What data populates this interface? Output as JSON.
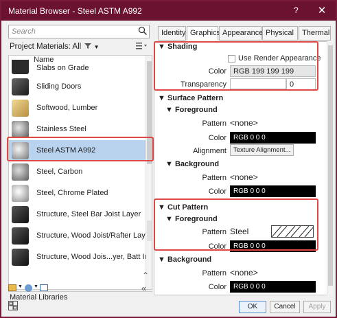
{
  "window": {
    "title": "Material Browser - Steel ASTM A992",
    "help": "?",
    "close": "✕"
  },
  "left": {
    "search_placeholder": "Search",
    "project_header": "Project Materials: All",
    "column_header": "Name",
    "items": [
      {
        "name": "Slabs on Grade",
        "thumb": "#2a2a2a"
      },
      {
        "name": "Sliding Doors",
        "thumb": "#3a3a3a"
      },
      {
        "name": "Softwood, Lumber",
        "thumb": "#d9b86a"
      },
      {
        "name": "Stainless Steel",
        "thumb": "#9a9a9a"
      },
      {
        "name": "Steel ASTM A992",
        "thumb": "#b8b8b8"
      },
      {
        "name": "Steel, Carbon",
        "thumb": "#9e9e9e"
      },
      {
        "name": "Steel, Chrome Plated",
        "thumb": "#c8c8c8"
      },
      {
        "name": "Structure, Steel Bar Joist Layer",
        "thumb": "#2e2e2e"
      },
      {
        "name": "Structure, Wood Joist/Rafter Layer",
        "thumb": "#333333"
      },
      {
        "name": "Structure, Wood Jois...yer, Batt Insulation",
        "thumb": "#3a3a3a"
      }
    ],
    "library_header": "Material Libraries"
  },
  "tabs": [
    "Identity",
    "Graphics",
    "Appearance",
    "Physical",
    "Thermal"
  ],
  "graphics": {
    "shading": {
      "title": "Shading",
      "use_render_label": "Use Render Appearance",
      "color_label": "Color",
      "color_value": "RGB 199 199 199",
      "transparency_label": "Transparency",
      "transparency_value": "0"
    },
    "surface": {
      "title": "Surface Pattern",
      "foreground": {
        "title": "Foreground",
        "pattern_label": "Pattern",
        "pattern_value": "<none>",
        "color_label": "Color",
        "color_value": "RGB 0 0 0",
        "alignment_label": "Alignment",
        "alignment_button": "Texture Alignment..."
      },
      "background": {
        "title": "Background",
        "pattern_label": "Pattern",
        "pattern_value": "<none>",
        "color_label": "Color",
        "color_value": "RGB 0 0 0"
      }
    },
    "cut": {
      "title": "Cut Pattern",
      "foreground": {
        "title": "Foreground",
        "pattern_label": "Pattern",
        "pattern_value": "Steel",
        "color_label": "Color",
        "color_value": "RGB 0 0 0"
      },
      "background": {
        "title": "Background",
        "pattern_label": "Pattern",
        "pattern_value": "<none>",
        "color_label": "Color",
        "color_value": "RGB 0 0 0"
      }
    }
  },
  "footer": {
    "ok": "OK",
    "cancel": "Cancel",
    "apply": "Apply"
  },
  "colors": {
    "titlebar": "#6a1230",
    "selection": "#b9d3ee",
    "highlight": "#e04848"
  }
}
